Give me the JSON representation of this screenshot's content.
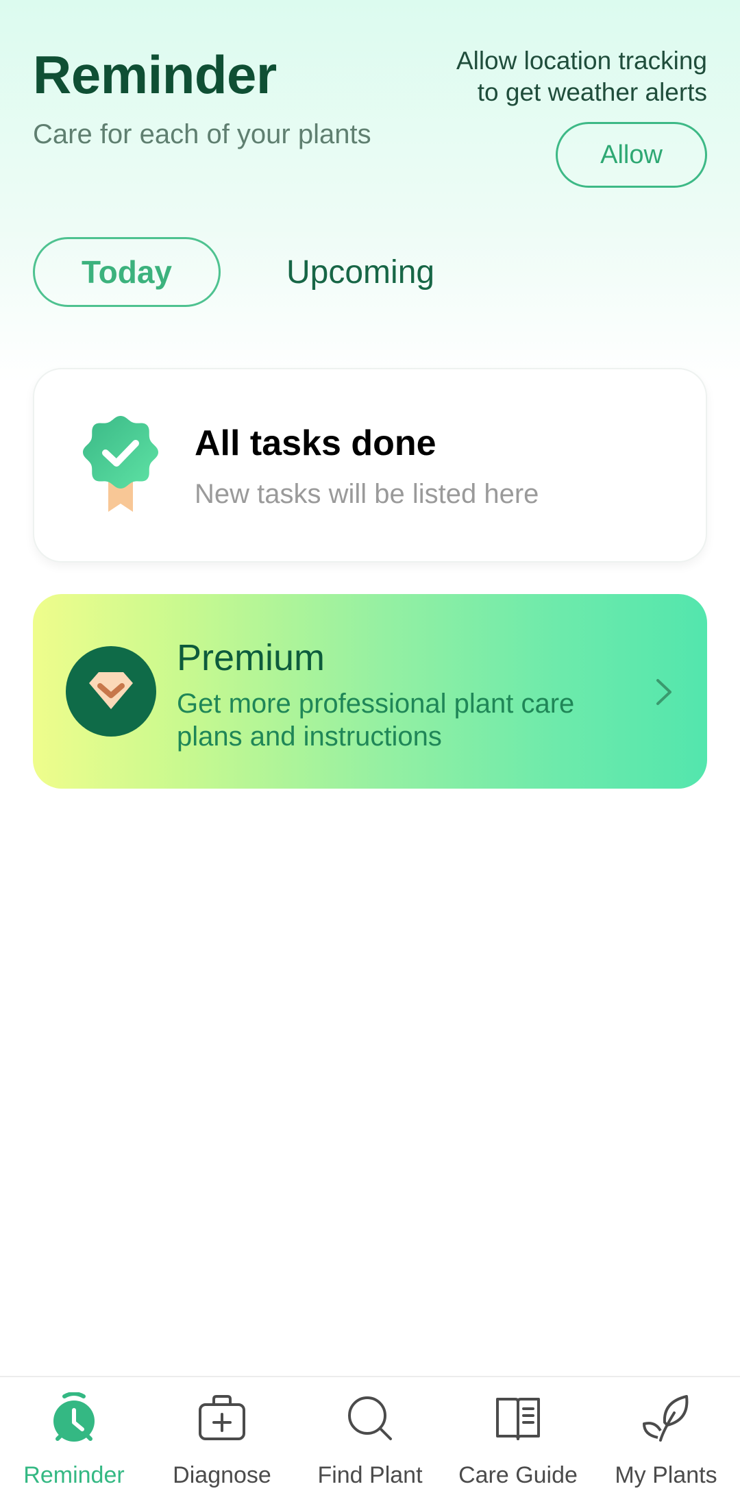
{
  "header": {
    "title": "Reminder",
    "subtitle": "Care for each of your plants",
    "location_prompt_line1": "Allow location tracking",
    "location_prompt_line2": "to get weather alerts",
    "allow_label": "Allow"
  },
  "tabs": [
    {
      "label": "Today",
      "selected": true
    },
    {
      "label": "Upcoming",
      "selected": false
    }
  ],
  "tasks_card": {
    "title": "All tasks done",
    "subtitle": "New tasks will be listed here",
    "icon": "award-check-icon"
  },
  "premium": {
    "title": "Premium",
    "description": "Get more professional plant care plans and instructions",
    "icon": "diamond-icon"
  },
  "bottom_nav": [
    {
      "label": "Reminder",
      "icon": "alarm-clock-icon",
      "active": true
    },
    {
      "label": "Diagnose",
      "icon": "medical-kit-icon",
      "active": false
    },
    {
      "label": "Find Plant",
      "icon": "search-icon",
      "active": false
    },
    {
      "label": "Care Guide",
      "icon": "book-icon",
      "active": false
    },
    {
      "label": "My Plants",
      "icon": "leaves-icon",
      "active": false
    }
  ],
  "colors": {
    "accent": "#34b883",
    "title": "#0f4f34",
    "premium_icon_bg": "#0f6b48"
  }
}
